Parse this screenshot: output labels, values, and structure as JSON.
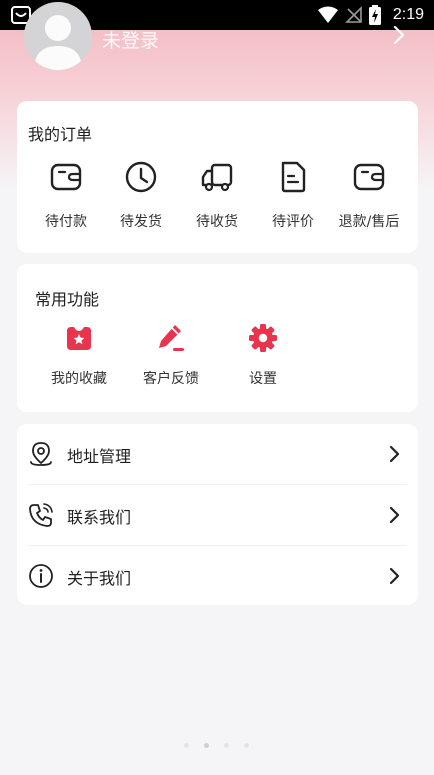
{
  "status_bar": {
    "time": "2:19",
    "icons": [
      "notification-app-icon",
      "wifi-icon",
      "no-sim-icon",
      "battery-charging-icon"
    ]
  },
  "profile": {
    "login_text": "未登录",
    "avatar_icon": "user-avatar-icon",
    "arrow_icon": "chevron-right-icon"
  },
  "orders": {
    "title": "我的订单",
    "items": [
      {
        "label": "待付款",
        "icon": "wallet-icon"
      },
      {
        "label": "待发货",
        "icon": "clock-icon"
      },
      {
        "label": "待收货",
        "icon": "truck-icon"
      },
      {
        "label": "待评价",
        "icon": "document-icon"
      },
      {
        "label": "退款/售后",
        "icon": "refund-wallet-icon"
      }
    ]
  },
  "functions": {
    "title": "常用功能",
    "accent_color": "#e8344f",
    "items": [
      {
        "label": "我的收藏",
        "icon": "favorites-star-icon"
      },
      {
        "label": "客户反馈",
        "icon": "pencil-feedback-icon"
      },
      {
        "label": "设置",
        "icon": "gear-icon"
      }
    ]
  },
  "menu": {
    "items": [
      {
        "label": "地址管理",
        "icon": "location-pin-icon"
      },
      {
        "label": "联系我们",
        "icon": "phone-icon"
      },
      {
        "label": "关于我们",
        "icon": "info-icon"
      }
    ]
  },
  "colors": {
    "header_gradient_top": "#f2b7bf",
    "page_background": "#f5f5f7",
    "accent": "#e8344f"
  }
}
